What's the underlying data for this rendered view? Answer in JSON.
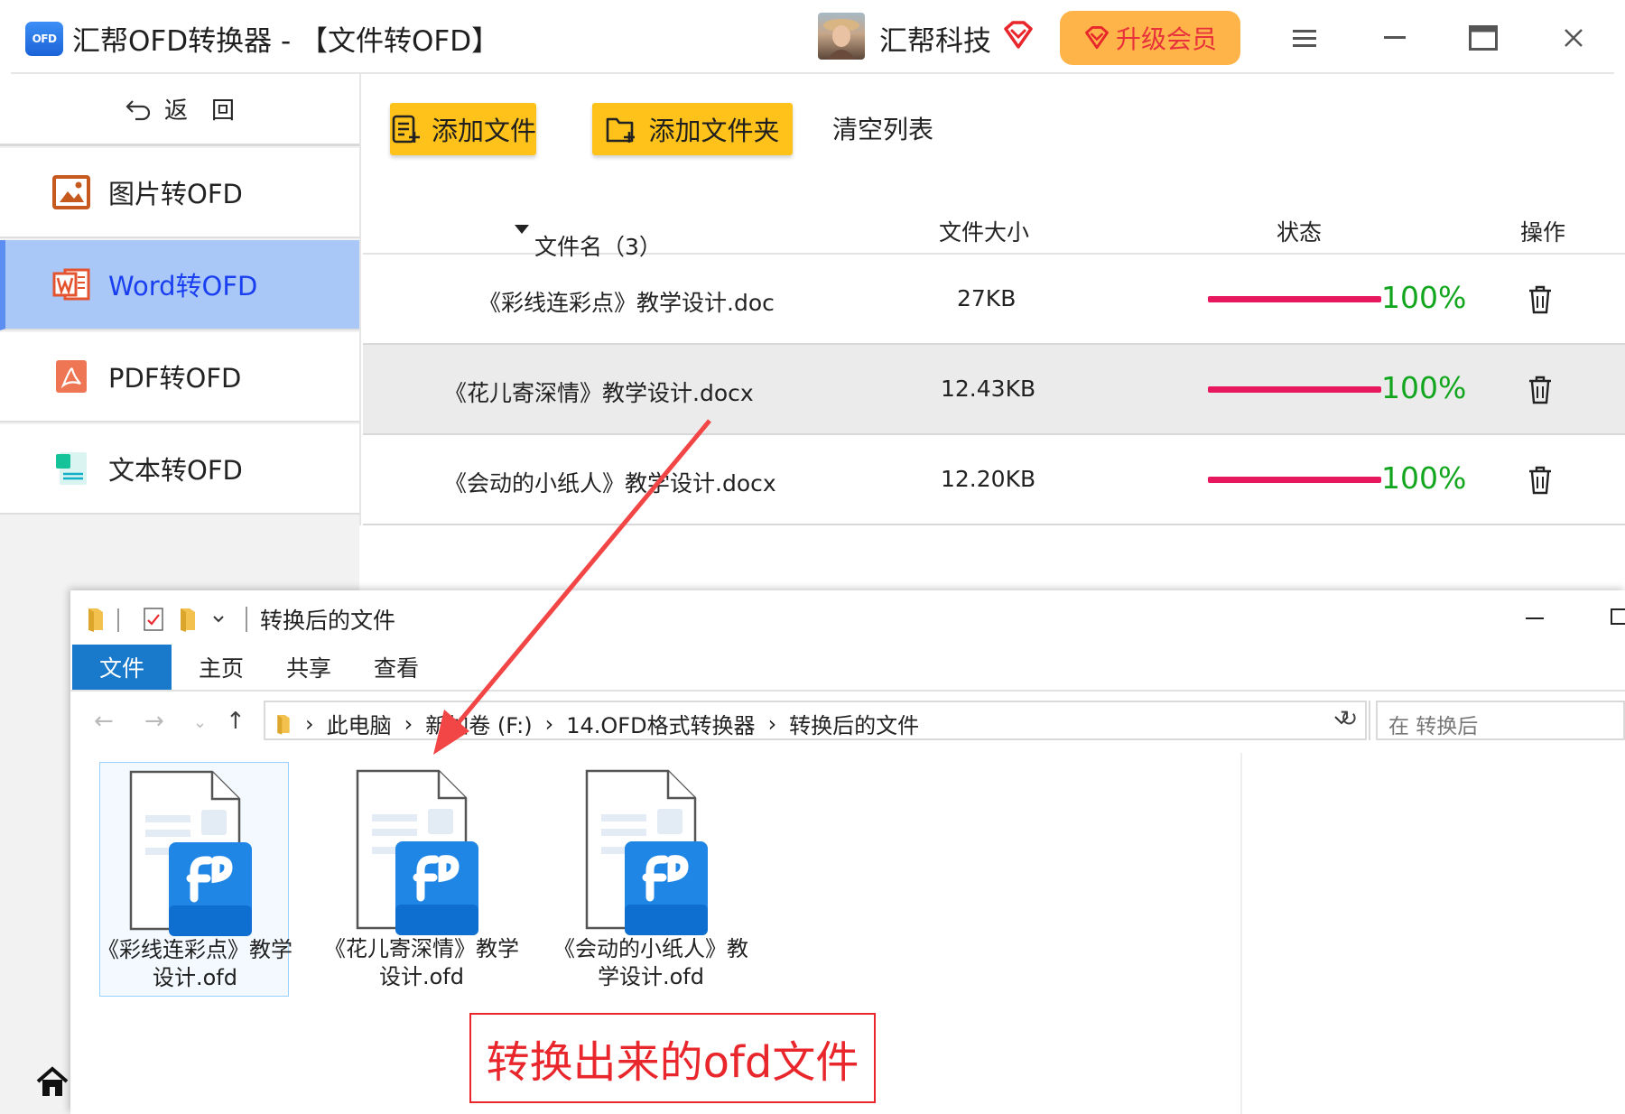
{
  "app": {
    "logo_text": "OFD",
    "title": "汇帮OFD转换器 - 【文件转OFD】",
    "user_name": "汇帮科技",
    "upgrade_label": "升级会员"
  },
  "sidebar": {
    "back_label": "返　回",
    "items": [
      {
        "label": "图片转OFD",
        "icon": "image-icon"
      },
      {
        "label": "Word转OFD",
        "icon": "word-icon",
        "active": true
      },
      {
        "label": "PDF转OFD",
        "icon": "pdf-icon"
      },
      {
        "label": "文本转OFD",
        "icon": "text-file-icon"
      }
    ]
  },
  "toolbar": {
    "add_file": "添加文件",
    "add_folder": "添加文件夹",
    "clear_list": "清空列表"
  },
  "table": {
    "headers": {
      "name": "文件名（3）",
      "size": "文件大小",
      "status": "状态",
      "action": "操作"
    },
    "rows": [
      {
        "name": "《彩线连彩点》教学设计.doc",
        "size": "27KB",
        "progress": 100,
        "status": "100%"
      },
      {
        "name": "《花儿寄深情》教学设计.docx",
        "size": "12.43KB",
        "progress": 100,
        "status": "100%"
      },
      {
        "name": "《会动的小纸人》教学设计.docx",
        "size": "12.20KB",
        "progress": 100,
        "status": "100%"
      }
    ]
  },
  "explorer": {
    "title": "转换后的文件",
    "tabs": [
      "文件",
      "主页",
      "共享",
      "查看"
    ],
    "breadcrumb": [
      "此电脑",
      "新加卷 (F:)",
      "14.OFD格式转换器",
      "转换后的文件"
    ],
    "search_placeholder": "在 转换后",
    "files": [
      {
        "name": "《彩线连彩点》教学设计.ofd",
        "selected": true
      },
      {
        "name": "《花儿寄深情》教学设计.ofd",
        "selected": false
      },
      {
        "name": "《会动的小纸人》教学设计.ofd",
        "selected": false
      }
    ]
  },
  "annotation": {
    "label": "转换出来的ofd文件"
  },
  "colors": {
    "accent_yellow": "#ffc21a",
    "upgrade_orange": "#ffb44a",
    "progress_pink": "#e8185f",
    "status_green": "#12a61f",
    "active_nav_bg": "#a9c8f7",
    "annotation_red": "#e8262b"
  }
}
